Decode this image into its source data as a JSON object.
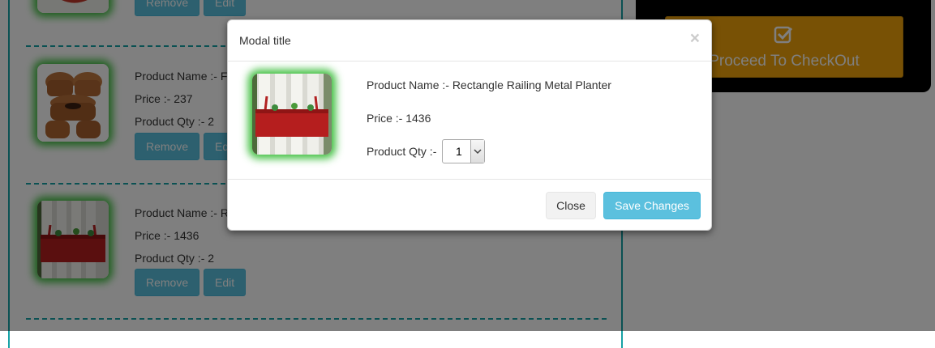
{
  "cart": {
    "items": [
      {
        "name_label": "",
        "price_label": "",
        "qty_label": "",
        "remove_label": "Remove",
        "edit_label": "Edit"
      },
      {
        "name_label": "Product Name :- F",
        "price_label": "Price :- 237",
        "qty_label": "Product Qty :- 2",
        "remove_label": "Remove",
        "edit_label": "Edit"
      },
      {
        "name_label": "Product Name :- R",
        "price_label": "Price :- 1436",
        "qty_label": "Product Qty :- 2",
        "remove_label": "Remove",
        "edit_label": "Edit"
      }
    ]
  },
  "checkout": {
    "label": "Proceed To CheckOut",
    "icon": "checkbox-check-icon"
  },
  "modal": {
    "title": "Modal title",
    "close_glyph": "×",
    "product_name": "Product Name :- Rectangle Railing Metal Planter",
    "price": "Price :- 1436",
    "qty_label": "Product Qty :-",
    "qty_value": "1",
    "close_button": "Close",
    "save_button": "Save Changes"
  },
  "colors": {
    "accent_teal": "#17a2a6",
    "button_info": "#5bc0de",
    "checkout_orange": "#f0a30a",
    "glow_green": "#3fbf3f"
  }
}
